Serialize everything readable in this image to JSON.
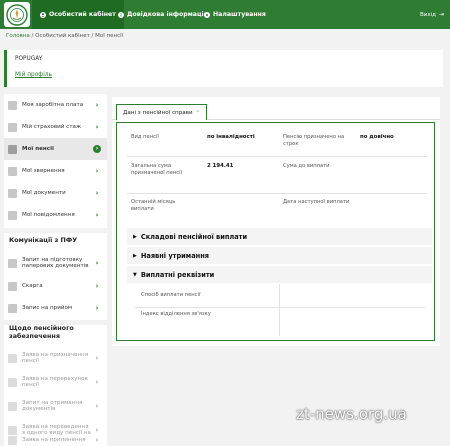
{
  "header": {
    "nav": [
      {
        "label": "Особистий кабінет",
        "icon": "user-icon"
      },
      {
        "label": "Довідкова інформація",
        "icon": "info-icon"
      },
      {
        "label": "Налаштування",
        "icon": "gear-icon"
      }
    ],
    "exit_label": "Вихід",
    "brand_color": "#2e7d32"
  },
  "breadcrumb": {
    "home": "Головна",
    "sep1": " / ",
    "cabinet": "Особистий кабінет",
    "sep2": " / ",
    "current": "Мої пенсії"
  },
  "profile": {
    "name": "POPUGAY",
    "link": "Мій профіль"
  },
  "sidebar": {
    "items": [
      {
        "label": "Моя заробітна плата"
      },
      {
        "label": "Мій страховий стаж"
      },
      {
        "label": "Мої пенсії"
      },
      {
        "label": "Мої звернення"
      },
      {
        "label": "Мої документи"
      },
      {
        "label": "Мої повідомлення"
      }
    ],
    "section_pfu": "Комунікації з ПФУ",
    "pfu_items": [
      {
        "label": "Запит на підготовку паперових документів"
      },
      {
        "label": "Скарга"
      },
      {
        "label": "Запис на прийом"
      }
    ],
    "section_pension": "Щодо пенсійного забезпечення",
    "pension_items": [
      {
        "label": "Заява на призначення пенсії"
      },
      {
        "label": "Заява на перерахунок пенсії"
      },
      {
        "label": "Запит на отримання документів"
      },
      {
        "label": "Заява на переведення з одного виду пенсії на"
      },
      {
        "label": "Заява на припинення"
      }
    ]
  },
  "main": {
    "tab_label": "Дані з пенсійної справи",
    "fields": {
      "pension_type_label": "Вид пенсії",
      "pension_type_value": "по інвалідності",
      "granted_term_label": "Пенсію призначено на строк",
      "granted_term_value": "по довічно",
      "total_label": "Загальна сума призначеної пенсії",
      "total_value": "2 194.41",
      "to_pay_label": "Сума до виплати",
      "last_month_label": "Останній місяць виплати",
      "next_date_label": "Дата наступної виплати"
    },
    "sections": [
      {
        "label": "Складові пенсійної виплати"
      },
      {
        "label": "Наявні утримання"
      },
      {
        "label": "Виплатні реквізити"
      }
    ],
    "requisites": {
      "method_label": "Спосіб виплати пенсії",
      "index_label": "Індекс відділення зв'язку"
    }
  },
  "watermark": "zt-news.org.ua"
}
